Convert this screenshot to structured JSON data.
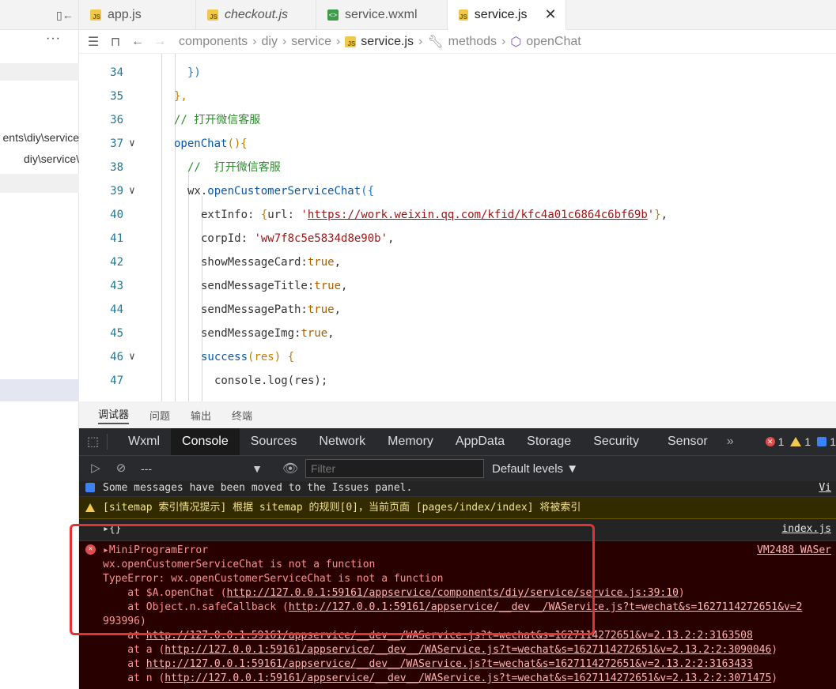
{
  "sidebar": {
    "toggle_icon": "panel-collapse-icon",
    "more_label": "···",
    "paths": [
      "ents\\diy\\service",
      "\\diy\\service"
    ]
  },
  "tabs": [
    {
      "label": "app.js",
      "icon": "js-file-icon"
    },
    {
      "label": "checkout.js",
      "icon": "js-file-icon"
    },
    {
      "label": "service.wxml",
      "icon": "wxml-file-icon"
    },
    {
      "label": "service.js",
      "icon": "js-file-icon"
    }
  ],
  "tab_close": "✕",
  "breadcrumb": [
    "components",
    "diy",
    "service",
    "service.js",
    "methods",
    "openChat"
  ],
  "editor": {
    "lines": [
      {
        "n": "34"
      },
      {
        "n": "35"
      },
      {
        "n": "36"
      },
      {
        "n": "37"
      },
      {
        "n": "38"
      },
      {
        "n": "39"
      },
      {
        "n": "40"
      },
      {
        "n": "41"
      },
      {
        "n": "42"
      },
      {
        "n": "43"
      },
      {
        "n": "44"
      },
      {
        "n": "45"
      },
      {
        "n": "46"
      },
      {
        "n": "47"
      }
    ],
    "code": {
      "l34": "})",
      "l35": "},",
      "l36": "// 打开微信客服",
      "l37_fn": "openChat",
      "l37_rest": "(){",
      "l38": "//  打开微信客服",
      "l39_obj": "wx.",
      "l39_fn": "openCustomerServiceChat",
      "l39_rest": "({",
      "l40_key": "extInfo: ",
      "l40_key2": "url: ",
      "l40_url": "https://work.weixin.qq.com/kfid/kfc4a01c6864c6bf69b",
      "l41_key": "corpId: ",
      "l41_val": "'ww7f8c5e5834d8e90b'",
      "l42_key": "showMessageCard:",
      "l43_key": "sendMessageTitle:",
      "l44_key": "sendMessagePath:",
      "l45_key": "sendMessageImg:",
      "bool": "true",
      "l46_fn": "success",
      "l46_rest": "(res) {",
      "l47": "console.log(res);"
    }
  },
  "panel_tabs": [
    "调试器",
    "问题",
    "输出",
    "终端"
  ],
  "devtools": {
    "tabs": [
      "Wxml",
      "Console",
      "Sources",
      "Network",
      "Memory",
      "AppData",
      "Storage",
      "Security",
      "Sensor"
    ],
    "more": "»",
    "error_count": "1",
    "warn_count": "1",
    "info_count": "1",
    "context": "---",
    "filter_placeholder": "Filter",
    "levels": "Default levels ▼"
  },
  "console": {
    "info_msg": "Some messages have been moved to the Issues panel.",
    "info_link": "Vi",
    "warn_msg": "[sitemap 索引情况提示] 根据 sitemap 的规则[0]，当前页面 [pages/index/index] 将被索引",
    "obj_msg": "▸{}",
    "obj_link": "index.js",
    "err_title": "▸MiniProgramError",
    "err_link": "VM2488 WASer",
    "err_lines": [
      "wx.openCustomerServiceChat is not a function",
      "TypeError: wx.openCustomerServiceChat is not a function"
    ],
    "stack": [
      {
        "prefix": "    at $A.openChat (",
        "link": "http://127.0.0.1:59161/appservice/components/diy/service/service.js:39:10",
        "suffix": ")"
      },
      {
        "prefix": "    at Object.n.safeCallback (",
        "link": "http://127.0.0.1:59161/appservice/__dev__/WAService.js?t=wechat&s=1627114272651&v=2",
        "suffix": ""
      },
      {
        "prefix": "",
        "link": "993996)",
        "suffix": ""
      },
      {
        "prefix": "    at ",
        "link": "http://127.0.0.1:59161/appservice/__dev__/WAService.js?t=wechat&s=1627114272651&v=2.13.2:2:3163508",
        "suffix": ""
      },
      {
        "prefix": "    at a (",
        "link": "http://127.0.0.1:59161/appservice/__dev__/WAService.js?t=wechat&s=1627114272651&v=2.13.2:2:3090046",
        "suffix": ")"
      },
      {
        "prefix": "    at ",
        "link": "http://127.0.0.1:59161/appservice/__dev__/WAService.js?t=wechat&s=1627114272651&v=2.13.2:2:3163433",
        "suffix": ""
      },
      {
        "prefix": "    at n (",
        "link": "http://127.0.0.1:59161/appservice/__dev__/WAService.js?t=wechat&s=1627114272651&v=2.13.2:2:3071475",
        "suffix": ")"
      }
    ]
  },
  "colors": {
    "highlight_box": "#e23333",
    "error_bg": "#290000",
    "warn_bg": "#332b00"
  }
}
